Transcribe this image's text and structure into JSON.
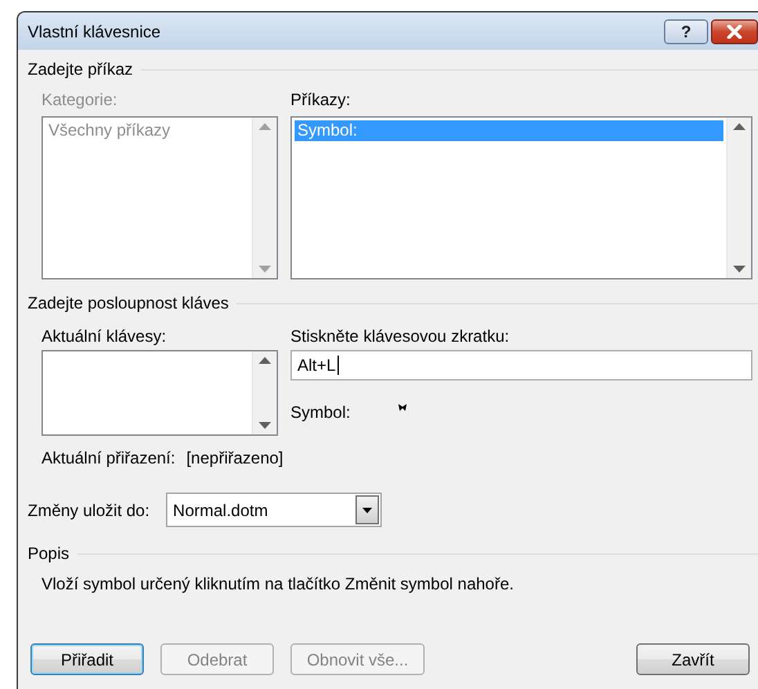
{
  "window": {
    "title": "Vlastní klávesnice",
    "help": "?"
  },
  "command_section": {
    "heading": "Zadejte příkaz",
    "categories": {
      "label": "Kategorie:",
      "disabled": true,
      "items": [
        {
          "text": "Všechny příkazy",
          "selected": false
        }
      ]
    },
    "commands": {
      "label": "Příkazy:",
      "items": [
        {
          "text": "Symbol:",
          "selected": true
        }
      ]
    }
  },
  "key_section": {
    "heading": "Zadejte posloupnost kláves",
    "current_keys": {
      "label": "Aktuální klávesy:"
    },
    "new_shortcut": {
      "label": "Stiskněte klávesovou zkratku:",
      "value": "Alt+L"
    },
    "preview_label": "Symbol:",
    "assignment": {
      "label": "Aktuální přiřazení:",
      "value": "[nepřiřazeno]"
    }
  },
  "save_to": {
    "label": "Změny uložit do:",
    "value": "Normal.dotm"
  },
  "description": {
    "heading": "Popis",
    "text": "Vloží symbol určený kliknutím na tlačítko Změnit symbol nahoře."
  },
  "buttons": [
    {
      "label": "Přiřadit",
      "disabled": false,
      "default": true
    },
    {
      "label": "Odebrat",
      "disabled": true,
      "default": false
    },
    {
      "label": "Obnovit vše...",
      "disabled": true,
      "default": false
    },
    {
      "label": "Zavřít",
      "disabled": false,
      "default": false
    }
  ]
}
